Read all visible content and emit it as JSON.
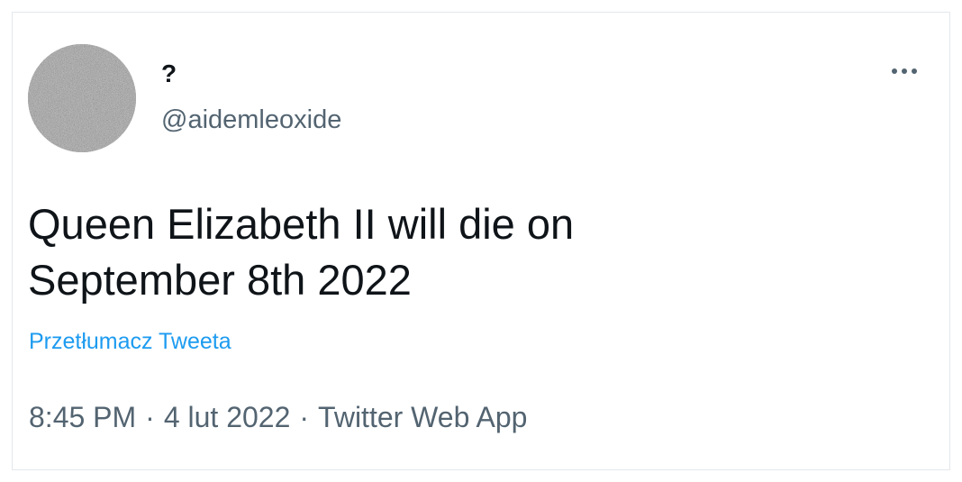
{
  "author": {
    "display_name": "?",
    "handle": "@aidemleoxide"
  },
  "tweet": {
    "text_lines": [
      "Queen Elizabeth II will die on",
      "September 8th 2022"
    ],
    "translate_label": "Przetłumacz Tweeta",
    "time": "8:45 PM",
    "date": "4 lut 2022",
    "separator": "·",
    "source": "Twitter Web App"
  },
  "icons": {
    "more": "more-horizontal-icon",
    "avatar": "noise-avatar"
  },
  "colors": {
    "text_primary": "#0f1419",
    "text_secondary": "#536471",
    "link": "#1d9bf0",
    "border": "#e4e8eb"
  }
}
